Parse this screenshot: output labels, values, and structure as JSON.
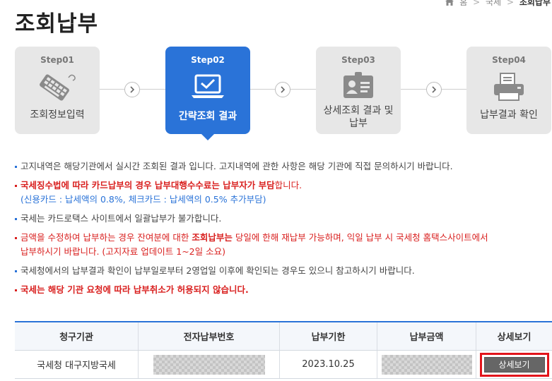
{
  "breadcrumb": {
    "items": [
      "홈",
      "국세"
    ],
    "current": "조회납부",
    "separator": ">"
  },
  "page_title": "조회납부",
  "steps": [
    {
      "num": "Step01",
      "label": "조회정보입력",
      "icon": "keyboard-icon"
    },
    {
      "num": "Step02",
      "label": "간략조회 결과",
      "icon": "laptop-check-icon"
    },
    {
      "num": "Step03",
      "label": "상세조회 결과 및 납부",
      "icon": "id-card-icon"
    },
    {
      "num": "Step04",
      "label": "납부결과 확인",
      "icon": "printer-icon"
    }
  ],
  "notes": {
    "n1": "고지내역은 해당기관에서 실시간 조회된 결과 입니다. 고지내역에 관한 사항은 해당 기관에 직접 문의하시기 바랍니다.",
    "n2_red": "국세징수법에 따라 카드납부의 경우 납부대행수수료는 납부자가 부담",
    "n2_rest": "합니다.",
    "n2_sub": "(신용카드 : 납세액의 0.8%, 체크카드 : 납세액의 0.5% 추가부담)",
    "n3": "국세는 카드로택스 사이트에서 일괄납부가 불가합니다.",
    "n4_a": "금액을 수정하여 납부하는 경우 잔여분에 대한 ",
    "n4_b": "조회납부는",
    "n4_c": " 당일에 한해 재납부 가능",
    "n4_d": "하며, 익일 납부 시 국세청 홈택스사이트에서",
    "n4_sub": "납부하시기 바랍니다. (고지자료 업데이트 1~2일 소요)",
    "n5": "국세청에서의 납부결과 확인이 납부일로부터 2영업일 이후에 확인되는 경우도 있으니 참고하시기 바랍니다.",
    "n6": "국세는 해당 기관 요청에 따라 납부취소가 허용되지 않습니다."
  },
  "table": {
    "headers": [
      "청구기관",
      "전자납부번호",
      "납부기한",
      "납부금액",
      "상세보기"
    ],
    "row": {
      "agency": "국세청 대구지방국세",
      "due_date": "2023.10.25",
      "detail_button": "상세보기"
    }
  },
  "colors": {
    "accent": "#2a73d8",
    "alert": "#d9201f",
    "highlight_border": "#e2141b"
  }
}
